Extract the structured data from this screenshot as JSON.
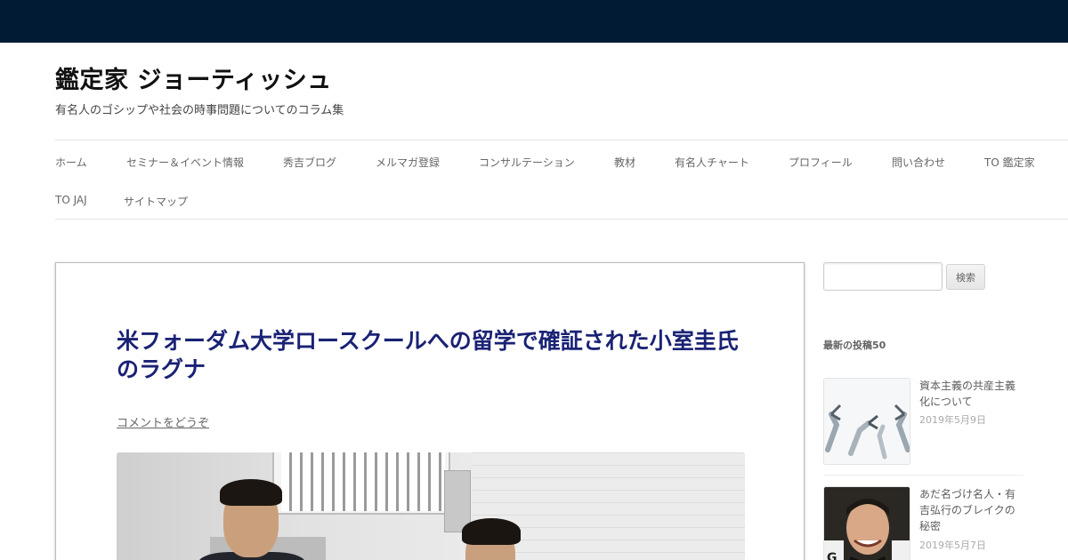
{
  "site": {
    "title": "鑑定家 ジョーティッシュ",
    "description": "有名人のゴシップや社会の時事問題についてのコラム集"
  },
  "nav": {
    "items": [
      "ホーム",
      "セミナー＆イベント情報",
      "秀吉ブログ",
      "メルマガ登録",
      "コンサルテーション",
      "教材",
      "有名人チャート",
      "プロフィール",
      "問い合わせ",
      "TO 鑑定家",
      "TO JAJ",
      "サイトマップ"
    ]
  },
  "article": {
    "title": "米フォーダム大学ロースクールへの留学で確証された小室圭氏のラグナ",
    "comment_link": "コメントをどうぞ"
  },
  "sidebar": {
    "search_button": "検索",
    "search_value": "",
    "recent_title": "最新の投稿50",
    "recent_posts": [
      {
        "title": "資本主義の共産主義化について",
        "date": "2019年5月9日"
      },
      {
        "title": "あだ名づけ名人・有吉弘行のブレイクの秘密",
        "date": "2019年5月7日"
      }
    ]
  },
  "colors": {
    "topbar": "#021b35",
    "article_title": "#1a2275"
  }
}
